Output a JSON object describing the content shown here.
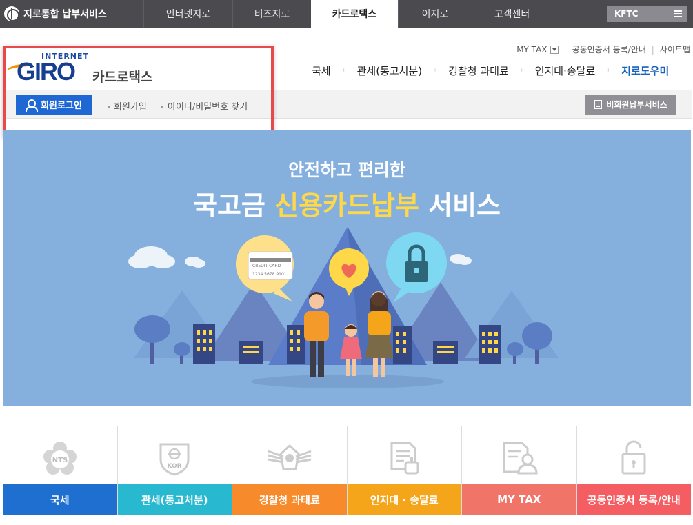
{
  "topbar": {
    "brand": "지로통합 납부서비스",
    "tabs": [
      {
        "label": "인터넷지로"
      },
      {
        "label": "비즈지로"
      },
      {
        "label": "카드로택스"
      },
      {
        "label": "이지로"
      },
      {
        "label": "고객센터"
      }
    ],
    "active_tab": "카드로택스",
    "kftc_label": "KFTC"
  },
  "util_links": {
    "mytax": "MY TAX",
    "cert": "공동인증서 등록/안내",
    "sitemap": "사이트맵"
  },
  "logo": {
    "internet": "INTERNET",
    "giro": "GIRO",
    "service": "카드로택스"
  },
  "main_nav": [
    "국세",
    "관세(통고처분)",
    "경찰청 과태료",
    "인지대·송달료",
    "지로도우미"
  ],
  "login_bar": {
    "login_button": "회원로그인",
    "signup": "회원가입",
    "find_id": "아이디/비밀번호 찾기",
    "nonmember_button": "비회원납부서비스"
  },
  "banner": {
    "subtitle": "안전하고 편리한",
    "title_pre": "국고금 ",
    "title_highlight": "신용카드납부",
    "title_post": " 서비스",
    "card_text": "CREDIT CARD",
    "card_number": "1234 5678 9101"
  },
  "tiles": [
    {
      "label": "국세",
      "color": "#1f6fd1",
      "icon": "nts-emblem-icon",
      "icon_text": "NTS"
    },
    {
      "label": "관세(통고처분)",
      "color": "#28b9d0",
      "icon": "kor-customs-emblem-icon",
      "icon_text": "KOR"
    },
    {
      "label": "경찰청 과태료",
      "color": "#f78a2a",
      "icon": "police-emblem-icon",
      "icon_text": ""
    },
    {
      "label": "인지대 · 송달료",
      "color": "#f5a51a",
      "icon": "document-stamp-icon",
      "icon_text": ""
    },
    {
      "label": "MY TAX",
      "color": "#f07468",
      "icon": "mytax-profile-icon",
      "icon_text": ""
    },
    {
      "label": "공동인증서 등록/안내",
      "color": "#f45e62",
      "icon": "lock-icon",
      "icon_text": ""
    }
  ],
  "colors": {
    "topbar": "#4a4a4f",
    "primary_blue": "#1f68d3",
    "banner_bg": "#85b0dd",
    "highlight": "#e84a4a"
  }
}
